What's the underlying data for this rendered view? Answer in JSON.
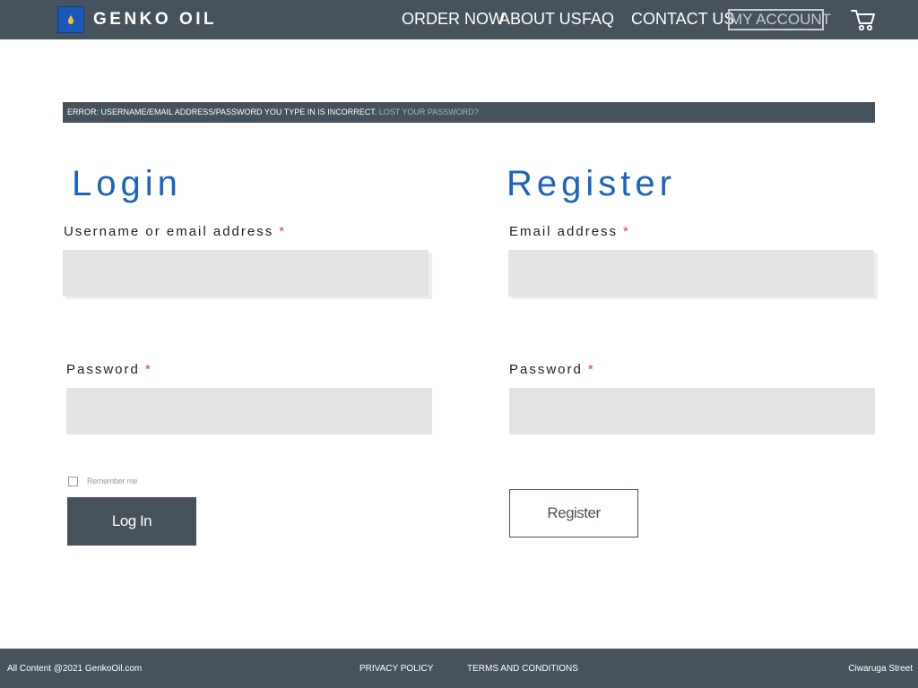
{
  "header": {
    "brand": "GENKO OIL",
    "logo_icon": "oil-drop-icon",
    "nav": {
      "order_now": "ORDER NOW",
      "about_us": "ABOUT US",
      "faq": "FAQ",
      "contact_us": "CONTACT US",
      "my_account": "MY ACCOUNT"
    },
    "cart_icon": "shopping-cart-icon"
  },
  "error": {
    "message": "ERROR: USERNAME/EMAIL ADDRESS/PASSWORD YOU TYPE IN IS INCORRECT.",
    "link": "LOST YOUR PASSWORD?"
  },
  "login": {
    "title": "Login",
    "username_label": "Username or email address",
    "username_value": "",
    "password_label": "Password",
    "password_value": "",
    "remember_label": "Remember me",
    "remember_checked": false,
    "submit_label": "Log In"
  },
  "register": {
    "title": "Register",
    "email_label": "Email address",
    "email_value": "",
    "password_label": "Password",
    "password_value": "",
    "submit_label": "Register"
  },
  "required_marker": "*",
  "footer": {
    "copyright": "All Content @2021 GenkoOil.com",
    "privacy": "PRIVACY POLICY",
    "terms": "TERMS AND CONDITIONS",
    "address": "Ciwaruga Street"
  },
  "colors": {
    "bar": "#47535c",
    "heading": "#1a63be",
    "required": "#d23a3a",
    "field": "#e3e3e3"
  }
}
